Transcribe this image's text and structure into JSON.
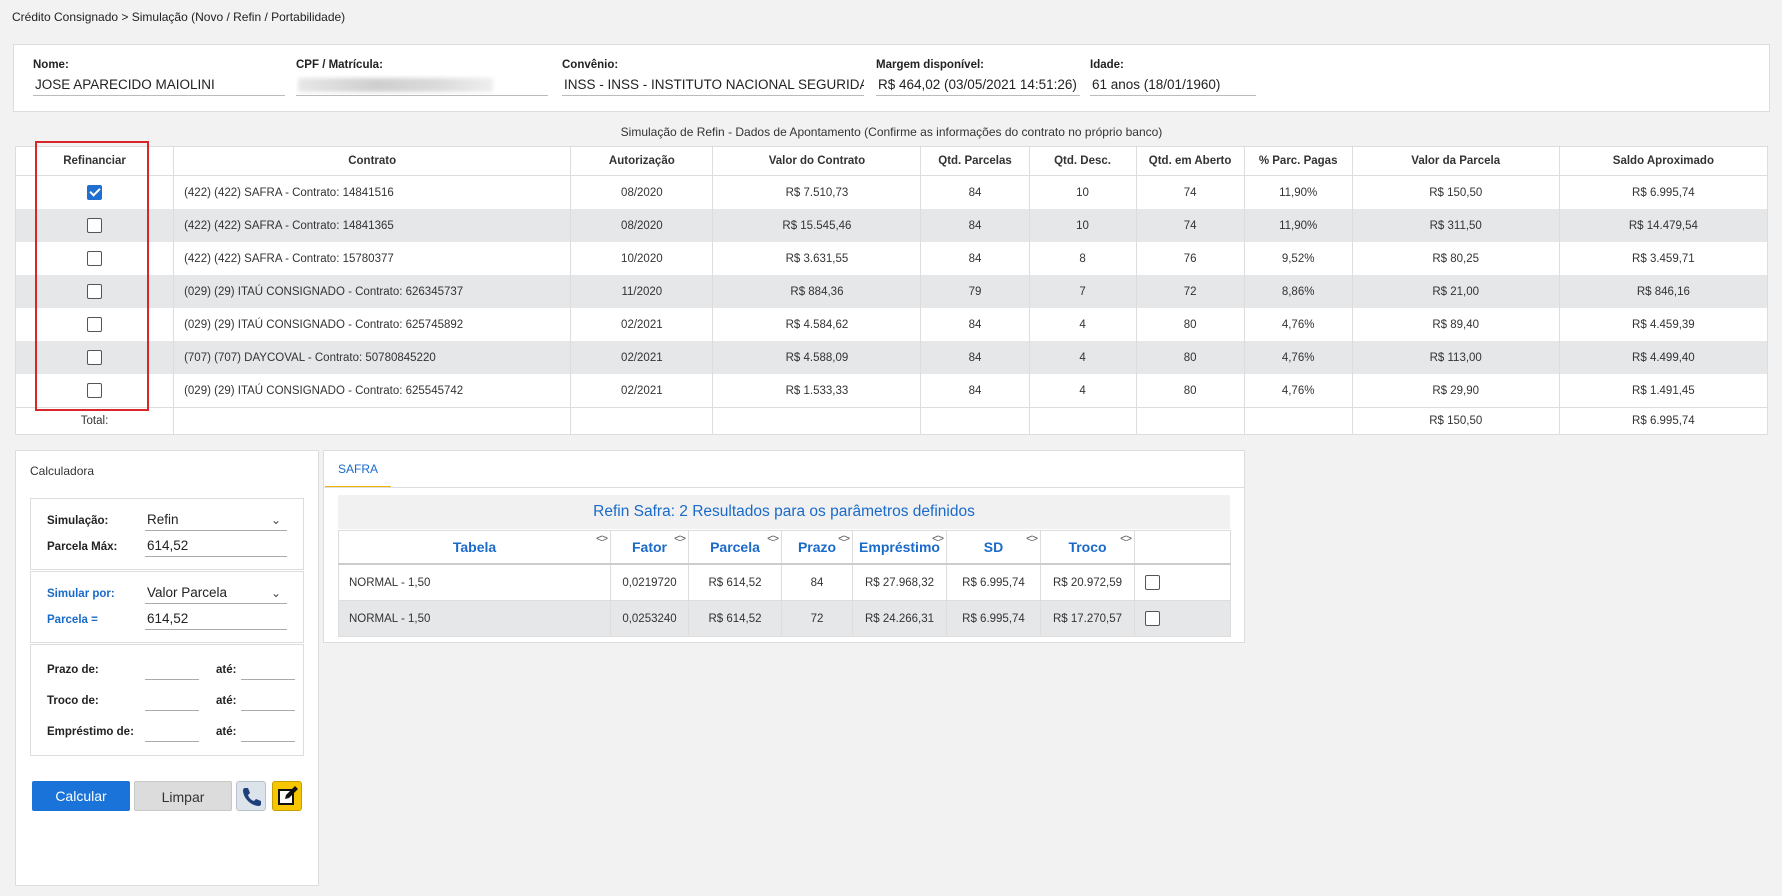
{
  "breadcrumb": "Crédito Consignado > Simulação (Novo / Refin / Portabilidade)",
  "client": {
    "nome_label": "Nome:",
    "nome": "JOSE APARECIDO MAIOLINI",
    "cpf_label": "CPF / Matrícula:",
    "convenio_label": "Convênio:",
    "convenio": "INSS - INSS - INSTITUTO NACIONAL SEGURIDADE",
    "margem_label": "Margem disponível:",
    "margem": "R$ 464,02 (03/05/2021 14:51:26)",
    "idade_label": "Idade:",
    "idade": "61 anos (18/01/1960)"
  },
  "refin": {
    "title": "Simulação de Refin - Dados de Apontamento (Confirme as informações do contrato no próprio banco)",
    "headers": [
      "Refinanciar",
      "Contrato",
      "Autorização",
      "Valor do Contrato",
      "Qtd. Parcelas",
      "Qtd. Desc.",
      "Qtd. em Aberto",
      "% Parc. Pagas",
      "Valor da Parcela",
      "Saldo Aproximado"
    ],
    "rows": [
      {
        "checked": true,
        "contrato": "(422) (422) SAFRA - Contrato: 14841516",
        "autorizacao": "08/2020",
        "valor": "R$ 7.510,73",
        "parcelas": "84",
        "desc": "10",
        "aberto": "74",
        "pagas": "11,90%",
        "parcela": "R$ 150,50",
        "saldo": "R$ 6.995,74"
      },
      {
        "checked": false,
        "contrato": "(422) (422) SAFRA - Contrato: 14841365",
        "autorizacao": "08/2020",
        "valor": "R$ 15.545,46",
        "parcelas": "84",
        "desc": "10",
        "aberto": "74",
        "pagas": "11,90%",
        "parcela": "R$ 311,50",
        "saldo": "R$ 14.479,54"
      },
      {
        "checked": false,
        "contrato": "(422) (422) SAFRA - Contrato: 15780377",
        "autorizacao": "10/2020",
        "valor": "R$ 3.631,55",
        "parcelas": "84",
        "desc": "8",
        "aberto": "76",
        "pagas": "9,52%",
        "parcela": "R$ 80,25",
        "saldo": "R$ 3.459,71"
      },
      {
        "checked": false,
        "contrato": "(029) (29) ITAÚ CONSIGNADO - Contrato: 626345737",
        "autorizacao": "11/2020",
        "valor": "R$ 884,36",
        "parcelas": "79",
        "desc": "7",
        "aberto": "72",
        "pagas": "8,86%",
        "parcela": "R$ 21,00",
        "saldo": "R$ 846,16"
      },
      {
        "checked": false,
        "contrato": "(029) (29) ITAÚ CONSIGNADO - Contrato: 625745892",
        "autorizacao": "02/2021",
        "valor": "R$ 4.584,62",
        "parcelas": "84",
        "desc": "4",
        "aberto": "80",
        "pagas": "4,76%",
        "parcela": "R$ 89,40",
        "saldo": "R$ 4.459,39"
      },
      {
        "checked": false,
        "contrato": "(707) (707) DAYCOVAL - Contrato: 50780845220",
        "autorizacao": "02/2021",
        "valor": "R$ 4.588,09",
        "parcelas": "84",
        "desc": "4",
        "aberto": "80",
        "pagas": "4,76%",
        "parcela": "R$ 113,00",
        "saldo": "R$ 4.499,40"
      },
      {
        "checked": false,
        "contrato": "(029) (29) ITAÚ CONSIGNADO - Contrato: 625545742",
        "autorizacao": "02/2021",
        "valor": "R$ 1.533,33",
        "parcelas": "84",
        "desc": "4",
        "aberto": "80",
        "pagas": "4,76%",
        "parcela": "R$ 29,90",
        "saldo": "R$ 1.491,45"
      }
    ],
    "total_label": "Total:",
    "total_parcela": "R$ 150,50",
    "total_saldo": "R$ 6.995,74"
  },
  "calc": {
    "title": "Calculadora",
    "simulacao_label": "Simulação:",
    "simulacao": "Refin",
    "parcela_max_label": "Parcela Máx:",
    "parcela_max": "614,52",
    "simular_por_label": "Simular por:",
    "simular_por": "Valor Parcela",
    "parcela_eq_label": "Parcela =",
    "parcela_eq": "614,52",
    "prazo_label": "Prazo de:",
    "troco_label": "Troco de:",
    "emprestimo_label": "Empréstimo de:",
    "ate_label": "até:",
    "btn_calcular": "Calcular",
    "btn_limpar": "Limpar"
  },
  "results": {
    "tab": "SAFRA",
    "header": "Refin Safra: 2 Resultados para os parâmetros definidos",
    "columns": [
      "Tabela",
      "Fator",
      "Parcela",
      "Prazo",
      "Empréstimo",
      "SD",
      "Troco"
    ],
    "sort_glyph": "<>",
    "rows": [
      {
        "tabela": "NORMAL - 1,50",
        "fator": "0,0219720",
        "parcela": "R$ 614,52",
        "prazo": "84",
        "emprestimo": "R$ 27.968,32",
        "sd": "R$ 6.995,74",
        "troco": "R$ 20.972,59"
      },
      {
        "tabela": "NORMAL - 1,50",
        "fator": "0,0253240",
        "parcela": "R$ 614,52",
        "prazo": "72",
        "emprestimo": "R$ 24.266,31",
        "sd": "R$ 6.995,74",
        "troco": "R$ 17.270,57"
      }
    ]
  },
  "colors": {
    "accent": "#1a73d9",
    "highlight_border": "#d9262a",
    "tab_underline": "#f0b400",
    "edit_button": "#f6c600"
  }
}
